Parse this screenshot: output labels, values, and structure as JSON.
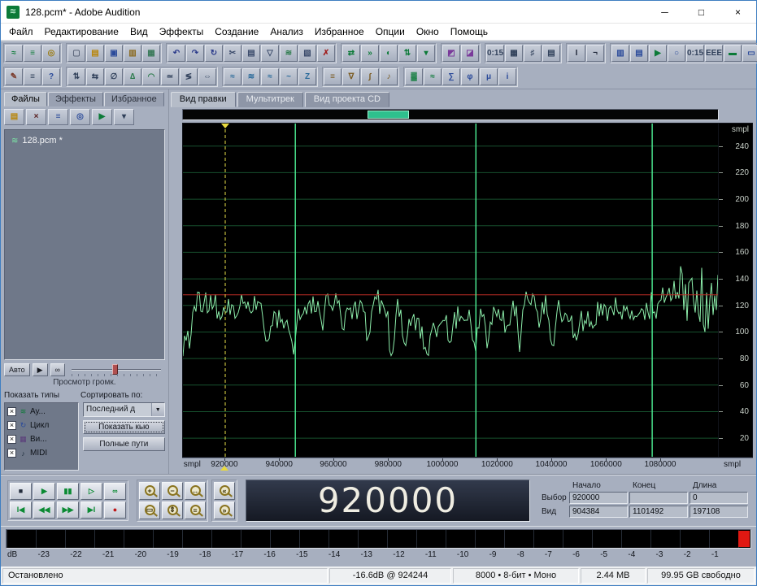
{
  "window": {
    "title": "128.pcm* - Adobe Audition",
    "app_icon": "≋",
    "minimize": "─",
    "maximize": "□",
    "close": "×"
  },
  "menu": {
    "items": [
      "Файл",
      "Редактирование",
      "Вид",
      "Эффекты",
      "Создание",
      "Анализ",
      "Избранное",
      "Опции",
      "Окно",
      "Помощь"
    ]
  },
  "toolbars": {
    "r1g1": [
      {
        "name": "edit-view-icon",
        "glyph": "≈",
        "color": "#0c7a38"
      },
      {
        "name": "multitrack-view-icon",
        "glyph": "≡",
        "color": "#0c7a38"
      },
      {
        "name": "cd-project-view-icon",
        "glyph": "◎",
        "color": "#9a7a10"
      }
    ],
    "r1g2": [
      {
        "name": "new-file-icon",
        "glyph": "▢",
        "color": "#5a6478"
      },
      {
        "name": "open-file-icon",
        "glyph": "▤",
        "color": "#b8860b"
      },
      {
        "name": "save-file-icon",
        "glyph": "▣",
        "color": "#2a4a9a"
      },
      {
        "name": "open-append-icon",
        "glyph": "▥",
        "color": "#8a6a20"
      },
      {
        "name": "batch-files-icon",
        "glyph": "▦",
        "color": "#3a7a5a"
      }
    ],
    "r1g3": [
      {
        "name": "undo-icon",
        "glyph": "↶",
        "color": "#2a3a8a"
      },
      {
        "name": "redo-icon",
        "glyph": "↷",
        "color": "#2a3a8a"
      },
      {
        "name": "repeat-command-icon",
        "glyph": "↻",
        "color": "#2a3a8a"
      },
      {
        "name": "cut-icon",
        "glyph": "✂",
        "color": "#3a4a6a"
      },
      {
        "name": "copy-icon",
        "glyph": "▤",
        "color": "#3a4a6a"
      },
      {
        "name": "paste-icon",
        "glyph": "▽",
        "color": "#3a4a6a"
      },
      {
        "name": "mix-paste-icon",
        "glyph": "≋",
        "color": "#2a7a4a"
      },
      {
        "name": "copy-to-new-icon",
        "glyph": "▧",
        "color": "#3a4a6a"
      },
      {
        "name": "delete-icon",
        "glyph": "✗",
        "color": "#a02020"
      }
    ],
    "r1g4": [
      {
        "name": "convert-sample-type-icon",
        "glyph": "⇄",
        "color": "#0c7a38"
      },
      {
        "name": "insert-to-multitrack-icon",
        "glyph": "»",
        "color": "#0c7a38"
      },
      {
        "name": "insert-to-cd-icon",
        "glyph": "◐",
        "color": "#0c7a38"
      },
      {
        "name": "group-waveform-normalize-icon",
        "glyph": "⇅",
        "color": "#0c7a38"
      },
      {
        "name": "marker-icon",
        "glyph": "▾",
        "color": "#0c7a38"
      }
    ],
    "r1g5": [
      {
        "name": "frequency-analysis-icon",
        "glyph": "◩",
        "color": "#7a3a9a"
      },
      {
        "name": "phase-analysis-icon",
        "glyph": "◪",
        "color": "#7a3a9a"
      }
    ],
    "r1g6": [
      {
        "name": "time-display-format-icon",
        "glyph": "0:15",
        "color": "#30405a"
      },
      {
        "name": "vertical-scale-format-icon",
        "glyph": "▦",
        "color": "#30405a"
      },
      {
        "name": "snapping-icon",
        "glyph": "♯",
        "color": "#30405a"
      },
      {
        "name": "grid-icon",
        "glyph": "▤",
        "color": "#30405a"
      }
    ],
    "r1g7": [
      {
        "name": "selection-tool-icon",
        "glyph": "I",
        "color": "#20283a"
      },
      {
        "name": "snap-to-zero-icon",
        "glyph": "¬",
        "color": "#20283a"
      }
    ],
    "r1g8": [
      {
        "name": "show-organizer-icon",
        "glyph": "▥",
        "color": "#2a4a9a"
      },
      {
        "name": "show-cue-list-icon",
        "glyph": "▤",
        "color": "#2a4a9a"
      },
      {
        "name": "show-transport-icon",
        "glyph": "▶",
        "color": "#0c7a38"
      },
      {
        "name": "show-zoom-controls-icon",
        "glyph": "○",
        "color": "#2a4a9a"
      },
      {
        "name": "show-time-window-icon",
        "glyph": "0:15",
        "color": "#30405a"
      },
      {
        "name": "show-sel-view-icon",
        "glyph": "EEE",
        "color": "#30405a"
      },
      {
        "name": "show-level-meters-icon",
        "glyph": "▬",
        "color": "#0c7a38"
      },
      {
        "name": "show-status-bar-icon",
        "glyph": "▭",
        "color": "#2a4a9a"
      }
    ],
    "r2g1": [
      {
        "name": "scripts-icon",
        "glyph": "✎",
        "color": "#7a3a2a"
      },
      {
        "name": "cue-list-icon",
        "glyph": "≡",
        "color": "#30405a"
      },
      {
        "name": "help-icon",
        "glyph": "?",
        "color": "#2a4a9a"
      }
    ],
    "r2g2": [
      {
        "name": "invert-icon",
        "glyph": "⇅",
        "color": "#30405a"
      },
      {
        "name": "reverse-icon",
        "glyph": "⇆",
        "color": "#30405a"
      },
      {
        "name": "silence-icon",
        "glyph": "∅",
        "color": "#30405a"
      },
      {
        "name": "amplify-icon",
        "glyph": "∆",
        "color": "#2a7a4a"
      },
      {
        "name": "envelope-icon",
        "glyph": "◠",
        "color": "#2a7a4a"
      },
      {
        "name": "normalize-icon",
        "glyph": "≃",
        "color": "#30405a"
      },
      {
        "name": "compressor-icon",
        "glyph": "≶",
        "color": "#30405a"
      },
      {
        "name": "stretch-icon",
        "glyph": "⇔",
        "color": "#30405a"
      }
    ],
    "r2g3": [
      {
        "name": "delay-icon",
        "glyph": "≈",
        "color": "#2a6a9a"
      },
      {
        "name": "echo-icon",
        "glyph": "≋",
        "color": "#2a6a9a"
      },
      {
        "name": "reverb-icon",
        "glyph": "≈",
        "color": "#2a6a9a"
      },
      {
        "name": "flanger-icon",
        "glyph": "~",
        "color": "#2a6a9a"
      },
      {
        "name": "distortion-icon",
        "glyph": "Z",
        "color": "#2a6a9a"
      }
    ],
    "r2g4": [
      {
        "name": "equalizer-icon",
        "glyph": "≡",
        "color": "#7a5a20"
      },
      {
        "name": "filter-icon",
        "glyph": "∇",
        "color": "#7a5a20"
      },
      {
        "name": "fft-filter-icon",
        "glyph": "∫",
        "color": "#7a5a20"
      },
      {
        "name": "pitch-icon",
        "glyph": "♪",
        "color": "#7a5a20"
      }
    ],
    "r2g5": [
      {
        "name": "spectral-view-icon",
        "glyph": "▓",
        "color": "#0c7a38"
      },
      {
        "name": "waveform-view-icon",
        "glyph": "≈",
        "color": "#0c7a38"
      },
      {
        "name": "frequency-window-icon",
        "glyph": "∑",
        "color": "#2a4a9a"
      },
      {
        "name": "phase-window-icon",
        "glyph": "φ",
        "color": "#2a4a9a"
      },
      {
        "name": "statistics-icon",
        "glyph": "μ",
        "color": "#2a4a9a"
      },
      {
        "name": "session-info-icon",
        "glyph": "i",
        "color": "#2a4a9a"
      }
    ]
  },
  "left_panel": {
    "tabs": [
      {
        "label": "Файлы"
      },
      {
        "label": "Эффекты"
      },
      {
        "label": "Избранное"
      }
    ],
    "toolbar": [
      {
        "name": "import-file-icon",
        "glyph": "▤",
        "color": "#b8860b"
      },
      {
        "name": "close-file-icon",
        "glyph": "×",
        "color": "#5a2020"
      },
      {
        "name": "insert-multitrack-icon",
        "glyph": "≡",
        "color": "#2a4a9a"
      },
      {
        "name": "insert-cd-project-icon",
        "glyph": "◎",
        "color": "#2a4a9a"
      },
      {
        "name": "play-preview-icon",
        "glyph": "▶",
        "color": "#0c7a38"
      },
      {
        "name": "options-icon",
        "glyph": "▾",
        "color": "#30405a"
      }
    ],
    "files": [
      {
        "icon": "≋",
        "name": "128.pcm *"
      }
    ],
    "preview": {
      "auto_label": "Авто",
      "play_glyph": "▶",
      "loop_glyph": "∞",
      "caption": "Просмотр громк."
    },
    "show_types_label": "Показать типы",
    "sort_label": "Сортировать по:",
    "check_glyph": "×",
    "types": [
      {
        "label": "Ау...",
        "glyph": "≋",
        "color": "#0c7a38"
      },
      {
        "label": "Цикл",
        "glyph": "↻",
        "color": "#2a4a9a"
      },
      {
        "label": "Ви...",
        "glyph": "▦",
        "color": "#5a3a7a"
      },
      {
        "label": "MIDI",
        "glyph": "♪",
        "color": "#203040"
      }
    ],
    "sort_value": "Последний д",
    "sort_arrow": "▼",
    "show_cues_button": "Показать кью",
    "full_paths_button": "Полные пути"
  },
  "edit_area": {
    "tabs": [
      {
        "label": "Вид правки"
      },
      {
        "label": "Мультитрек"
      },
      {
        "label": "Вид проекта CD"
      }
    ],
    "overview": {
      "sel_left_frac": 0.346,
      "sel_width_frac": 0.077
    },
    "waveform": {
      "unit": "smpl",
      "scale_ticks": [
        240,
        220,
        200,
        180,
        160,
        140,
        120,
        100,
        80,
        60,
        40,
        20
      ],
      "center_line_value": 128,
      "cursor_frac": 0.079,
      "cue_fracs": [
        0.21,
        0.5475,
        0.877
      ],
      "colors": {
        "wave": "#8deeab",
        "grid": "#17512e",
        "cue": "#4df095",
        "cursor": "#e8e049",
        "center": "#c22d26",
        "bg": "#000000"
      }
    },
    "ruler": {
      "left_unit": "smpl",
      "right_unit": "smpl",
      "labels": [
        {
          "text": "920000",
          "frac": 0.079
        },
        {
          "text": "940000",
          "frac": 0.181
        },
        {
          "text": "960000",
          "frac": 0.282
        },
        {
          "text": "980000",
          "frac": 0.384
        },
        {
          "text": "1000000",
          "frac": 0.485
        },
        {
          "text": "1020000",
          "frac": 0.587
        },
        {
          "text": "1040000",
          "frac": 0.688
        },
        {
          "text": "1060000",
          "frac": 0.79
        },
        {
          "text": "1080000",
          "frac": 0.891
        }
      ]
    }
  },
  "transport": {
    "row1": [
      {
        "name": "stop-button",
        "glyph": "■",
        "color": "#232c3b"
      },
      {
        "name": "play-button",
        "glyph": "▶",
        "color": "#0b8a33"
      },
      {
        "name": "pause-button",
        "glyph": "▮▮",
        "color": "#0b8a33"
      },
      {
        "name": "play-from-cursor-button",
        "glyph": "▷",
        "color": "#0b8a33"
      },
      {
        "name": "play-looped-button",
        "glyph": "∞",
        "color": "#0b8a33"
      }
    ],
    "row2": [
      {
        "name": "go-to-start-button",
        "glyph": "I◀",
        "color": "#0b8a33"
      },
      {
        "name": "rewind-button",
        "glyph": "◀◀",
        "color": "#0b8a33"
      },
      {
        "name": "fast-forward-button",
        "glyph": "▶▶",
        "color": "#0b8a33"
      },
      {
        "name": "go-to-end-button",
        "glyph": "▶I",
        "color": "#0b8a33"
      },
      {
        "name": "record-button",
        "glyph": "●",
        "color": "#c01818"
      }
    ],
    "zoom_group1": [
      {
        "name": "zoom-in-button",
        "glyph": "+"
      },
      {
        "name": "zoom-out-button",
        "glyph": "−"
      },
      {
        "name": "zoom-full-button",
        "glyph": "↔"
      },
      {
        "name": "zoom-selection-button",
        "glyph": "▭"
      },
      {
        "name": "zoom-in-vertical-button",
        "glyph": "⇕"
      },
      {
        "name": "zoom-out-vertical-button",
        "glyph": "≡"
      }
    ],
    "zoom_group2": [
      {
        "name": "zoom-to-left-edge-button",
        "glyph": "«"
      },
      {
        "name": "zoom-to-right-edge-button",
        "glyph": "»"
      }
    ],
    "display": "920000"
  },
  "info": {
    "headers": [
      "Начало",
      "Конец",
      "Длина"
    ],
    "rows": [
      {
        "label": "Выбор",
        "cells": [
          "920000",
          "",
          "0"
        ]
      },
      {
        "label": "Вид",
        "cells": [
          "904384",
          "1101492",
          "197108"
        ]
      }
    ]
  },
  "meter": {
    "scale": [
      "dB",
      "-23",
      "-22",
      "-21",
      "-20",
      "-19",
      "-18",
      "-17",
      "-16",
      "-15",
      "-14",
      "-13",
      "-12",
      "-11",
      "-10",
      "-9",
      "-8",
      "-7",
      "-6",
      "-5",
      "-4",
      "-3",
      "-2",
      "-1"
    ],
    "clip_color": "#e01812"
  },
  "status": {
    "cells": [
      "Остановлено",
      "-16.6dB @ 924244",
      "8000 • 8-бит • Моно",
      "2.44 MB",
      "99.95 GB свободно"
    ]
  }
}
